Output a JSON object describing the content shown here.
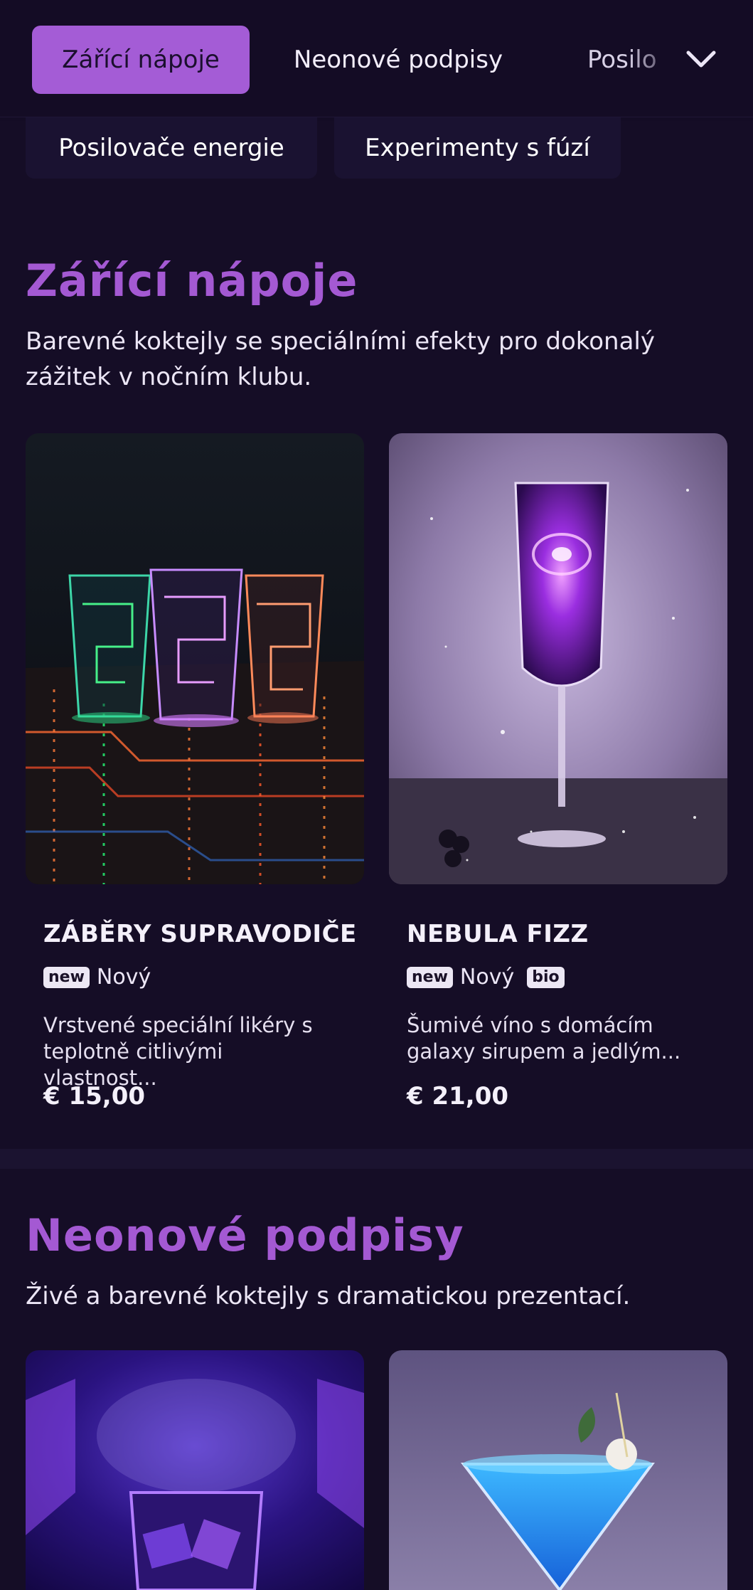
{
  "nav": {
    "row1": [
      "Zářící nápoje",
      "Neonové podpisy",
      "Posilo"
    ],
    "row2": [
      "Posilovače energie",
      "Experimenty s fúzí"
    ],
    "expand_icon": "chevron-down-icon"
  },
  "colors": {
    "background": "#150d26",
    "accent": "#a45cd6",
    "title": "#a459d3"
  },
  "sections": [
    {
      "title": "Zářící nápoje",
      "description": "Barevné koktejly se speciálními efekty pro dokonalý zážitek v nočním klubu.",
      "items": [
        {
          "name": "ZÁBĚRY SUPRAVODIČE",
          "badge": "new",
          "badge_label": "Nový",
          "extra_badge": "",
          "description_line1": "Vrstvené speciální likéry s",
          "description_line2": "teplotně citlivými vlastnost...",
          "price": "€ 15,00"
        },
        {
          "name": "NEBULA FIZZ",
          "badge": "new",
          "badge_label": "Nový",
          "extra_badge": "bio",
          "description_line1": "Šumivé víno s domácím",
          "description_line2": "galaxy sirupem a jedlým...",
          "price": "€ 21,00"
        }
      ]
    },
    {
      "title": "Neonové podpisy",
      "description": "Živé a barevné koktejly s dramatickou prezentací."
    }
  ]
}
